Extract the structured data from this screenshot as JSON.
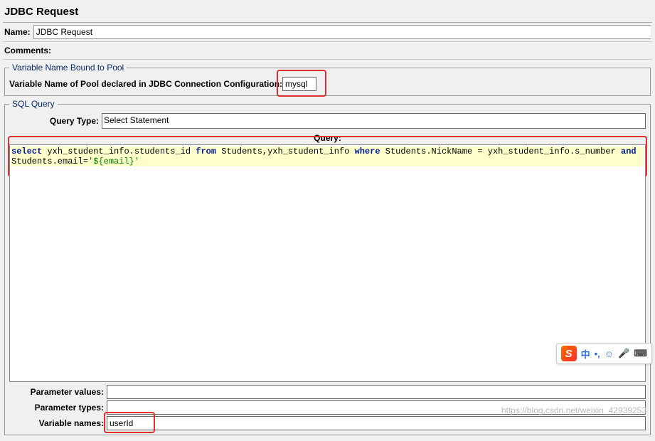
{
  "title": "JDBC Request",
  "name_label": "Name:",
  "name_value": "JDBC Request",
  "comments_label": "Comments:",
  "pool_section_legend": "Variable Name Bound to Pool",
  "pool_label": "Variable Name of Pool declared in JDBC Connection Configuration:",
  "pool_value": "mysql",
  "sql_section_legend": "SQL Query",
  "query_type_label": "Query Type:",
  "query_type_value": "Select Statement",
  "query_label": "Query:",
  "sql_tokens": {
    "select": "select",
    "col": " yxh_student_info.students_id ",
    "from": "from",
    "tables": " Students,yxh_student_info ",
    "where": "where",
    "cond": " Students.NickName = yxh_student_info.s_number ",
    "and": "and",
    "line2a": "Students.email=",
    "str": "'${email}'"
  },
  "param_values_label": "Parameter values:",
  "param_types_label": "Parameter types:",
  "variable_names_label": "Variable names:",
  "variable_names_value": "userId",
  "ime": {
    "cn": "中",
    "punct": "•,",
    "smile": "☺",
    "mic": "🎤",
    "kbd": "⌨"
  },
  "watermark": "https://blog.csdn.net/weixin_42939253"
}
